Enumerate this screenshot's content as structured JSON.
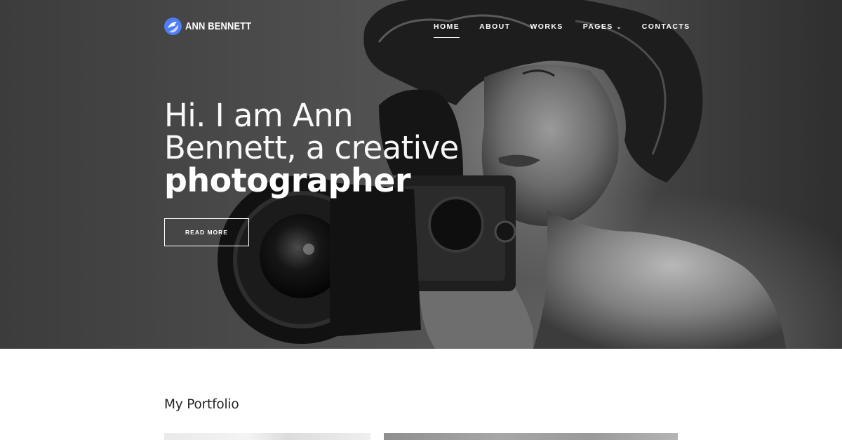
{
  "header": {
    "logo_text": "ANN BENNETT",
    "nav": [
      {
        "label": "HOME",
        "active": true
      },
      {
        "label": "ABOUT",
        "active": false
      },
      {
        "label": "WORKS",
        "active": false
      },
      {
        "label": "PAGES",
        "active": false,
        "has_dropdown": true
      },
      {
        "label": "CONTACTS",
        "active": false
      }
    ],
    "dropdown_icon": "chevron-down-icon"
  },
  "hero": {
    "line1": "Hi. I am Ann",
    "line2": "Bennett, a creative",
    "line3": "photographer",
    "button_label": "READ MORE",
    "image": "black-and-white photo of a woman with curly hair holding a medium-format camera"
  },
  "portfolio": {
    "title": "My Portfolio"
  },
  "colors": {
    "logo_accent": "#4f7df3",
    "text_dark": "#222222",
    "hero_text": "#ffffff",
    "background": "#ffffff"
  }
}
